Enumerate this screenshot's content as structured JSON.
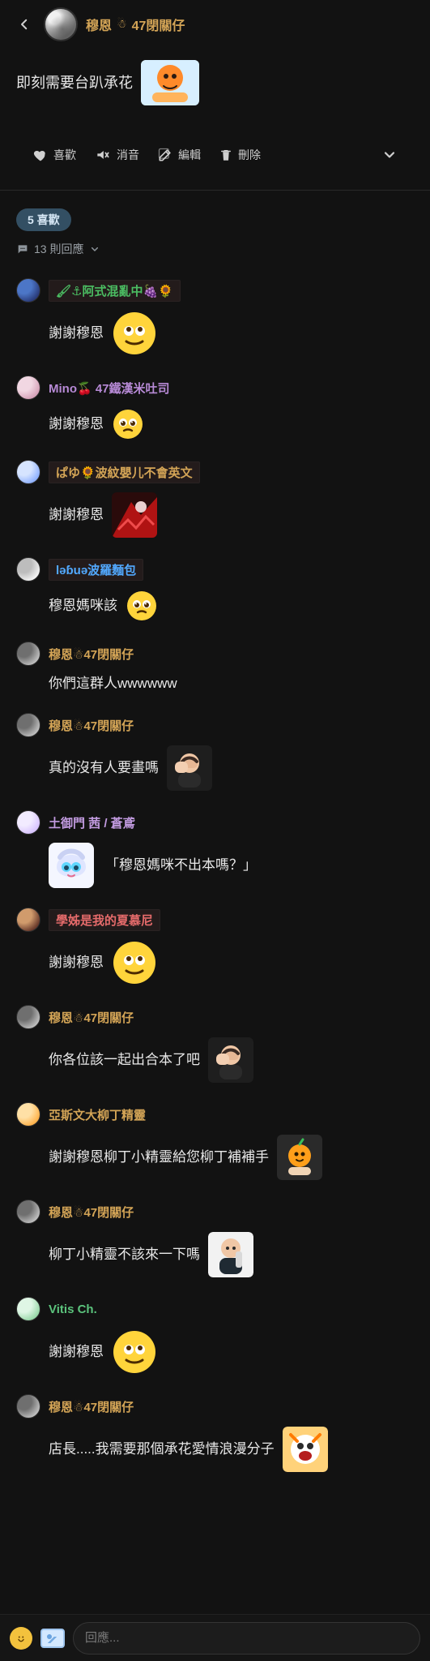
{
  "header": {
    "username": "穆恩",
    "name_emoji": "☃",
    "name_suffix": "47閉關仔"
  },
  "post": {
    "text": "即刻需要台趴承花"
  },
  "actions": {
    "like": "喜歡",
    "mute": "消音",
    "edit": "編輯",
    "delete": "刪除"
  },
  "likes": {
    "pill": "5 喜歡"
  },
  "replies": {
    "count_label": "13 則回應"
  },
  "comments": [
    {
      "name": "🖌⚓阿式混亂中🍇🌻",
      "name_color": "#4bbd62",
      "highlight": true,
      "text": "謝謝穆恩",
      "sticker": "roll-eyes-large"
    },
    {
      "name": "Mino🍒 47鐵漢米吐司",
      "name_color": "#b78ad6",
      "highlight": false,
      "text": "謝謝穆恩",
      "sticker": "pleading"
    },
    {
      "name": "ぱゆ🌻波紋嬰儿不會英文",
      "name_color": "#d3a456",
      "highlight": true,
      "text": "謝謝穆恩",
      "sticker": "red-image"
    },
    {
      "name": "ləɓuə波羅麵包",
      "name_color": "#52a9ff",
      "highlight": true,
      "text": "穆恩媽咪該",
      "sticker": "pleading"
    },
    {
      "name": "穆恩☃47閉關仔",
      "name_color": "#d3a456",
      "highlight": false,
      "text": "你們這群人wwwwww",
      "sticker": ""
    },
    {
      "name": "穆恩☃47閉關仔",
      "name_color": "#d3a456",
      "highlight": false,
      "text": "真的沒有人要畫嗎",
      "sticker": "man-rubbing-eyes"
    },
    {
      "name": "土御門 茜 / 蒼鳶",
      "name_color": "#c29be0",
      "highlight": false,
      "text": "「穆恩媽咪不出本嗎？」",
      "sticker": "anime-girl",
      "quote": true
    },
    {
      "name": "學姊是我的夏慕尼",
      "name_color": "#e66b6b",
      "highlight": true,
      "text": "謝謝穆恩",
      "sticker": "roll-eyes-large"
    },
    {
      "name": "穆恩☃47閉關仔",
      "name_color": "#d3a456",
      "highlight": false,
      "text": "你各位該一起出合本了吧",
      "sticker": "man-rubbing-eyes"
    },
    {
      "name": "亞斯文大柳丁精靈",
      "name_color": "#d3a456",
      "highlight": false,
      "text": "謝謝穆恩柳丁小精靈給您柳丁補補手",
      "sticker": "orange-spirit"
    },
    {
      "name": "穆恩☃47閉關仔",
      "name_color": "#d3a456",
      "highlight": false,
      "text": "柳丁小精靈不該來一下嗎",
      "sticker": "man-bottle"
    },
    {
      "name": "Vitis Ch.",
      "name_color": "#5bc37c",
      "highlight": false,
      "text": "謝謝穆恩",
      "sticker": "roll-eyes-large"
    },
    {
      "name": "穆恩☃47閉關仔",
      "name_color": "#d3a456",
      "highlight": false,
      "text": "店長.....我需要那個承花愛情浪漫分子",
      "sticker": "cartoon-screaming"
    }
  ],
  "composer": {
    "placeholder": "回應..."
  },
  "colors": {
    "gold": "#d3a456"
  }
}
